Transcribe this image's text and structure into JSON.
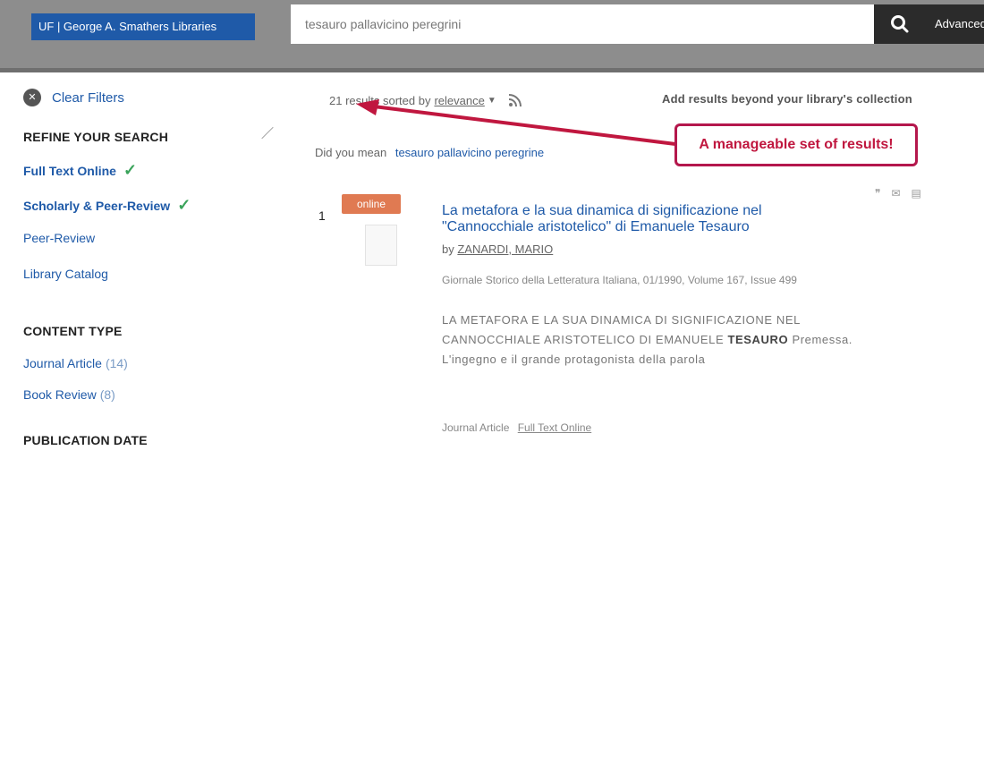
{
  "header": {
    "logo_text": "UF | George A. Smathers Libraries",
    "search_value": "tesauro pallavicino peregrini",
    "search_icon": "search-icon",
    "advanced_label": "Advanced"
  },
  "sidebar": {
    "clear_filters": "Clear Filters",
    "refine_heading": "REFINE YOUR SEARCH",
    "refine_items": [
      {
        "label": "Full Text Online"
      },
      {
        "label": "Scholarly & Peer-Review"
      },
      {
        "label": "Peer-Review"
      },
      {
        "label": "Library Catalog"
      }
    ],
    "content_type_heading": "CONTENT TYPE",
    "content_types": [
      {
        "label": "Journal Article",
        "count": "(14)"
      },
      {
        "label": "Book Review",
        "count": "(8)"
      }
    ],
    "publication_date_heading": "PUBLICATION DATE"
  },
  "results": {
    "summary_prefix": "21 results sorted by",
    "sort_label": "relevance",
    "add_beyond": "Add results beyond your library's collection",
    "did_you_mean_label": "Did you mean",
    "did_you_mean_link": "tesauro pallavicino peregrine",
    "annotation": "A manageable set of results!",
    "items": [
      {
        "number": "1",
        "badge": "online",
        "title": "La metafora e la sua dinamica di significazione nel \"Cannocchiale aristotelico\" di Emanuele Tesauro",
        "author_prefix": "by",
        "author": "ZANARDI, MARIO",
        "source": "Giornale Storico della Letteratura Italiana, 01/1990, Volume 167, Issue 499",
        "snippet_text": "LA METAFORA E LA SUA DINAMICA DI SIGNIFICAZIONE NEL CANNOCCHIALE ARISTOTELICO DI EMANUELE",
        "snippet_bold": "TESAURO",
        "snippet_rest": "Premessa. L'ingegno e il grande protagonista della parola",
        "type": "Journal Article",
        "fulltext_link": "Full Text Online"
      }
    ]
  },
  "colors": {
    "header_bg": "#8d8d8d",
    "logo_bg": "#1f5aa8",
    "link": "#1f5aa8",
    "annotation": "#c0173f",
    "badge": "#e07a52",
    "check": "#3aa35a"
  }
}
